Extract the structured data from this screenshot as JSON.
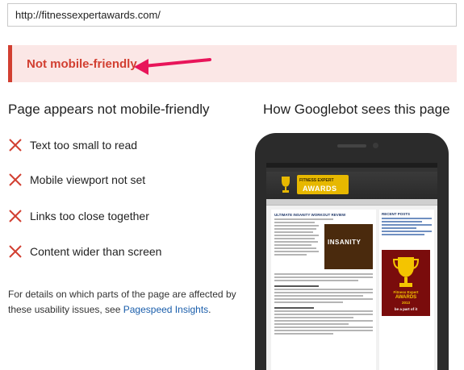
{
  "url": "http://fitnessexpertawards.com/",
  "verdict": "Not mobile-friendly",
  "issues": {
    "title": "Page appears not mobile-friendly",
    "items": [
      {
        "label": "Text too small to read"
      },
      {
        "label": "Mobile viewport not set"
      },
      {
        "label": "Links too close together"
      },
      {
        "label": "Content wider than screen"
      }
    ],
    "details_prefix": "For details on which parts of the page are affected by these usability issues, see ",
    "details_link": "Pagespeed Insights",
    "details_suffix": "."
  },
  "googlebot": {
    "title": "How Googlebot sees this page",
    "preview": {
      "logo_line1": "FITNESS EXPERT",
      "logo_line2": "AWARDS",
      "article_title": "ULTIMATE INSANITY WORKOUT REVIEW",
      "poster_text": "INSANITY",
      "side_heading": "RECENT POSTS",
      "award_line1": "Fitness Expert",
      "award_line2": "AWARDS",
      "award_line3": "2013",
      "award_line4": "be a part of it"
    }
  },
  "colors": {
    "error": "#d23f31",
    "verdict_bg": "#fbe7e6",
    "link": "#1a5eab",
    "arrow": "#e8155a"
  }
}
